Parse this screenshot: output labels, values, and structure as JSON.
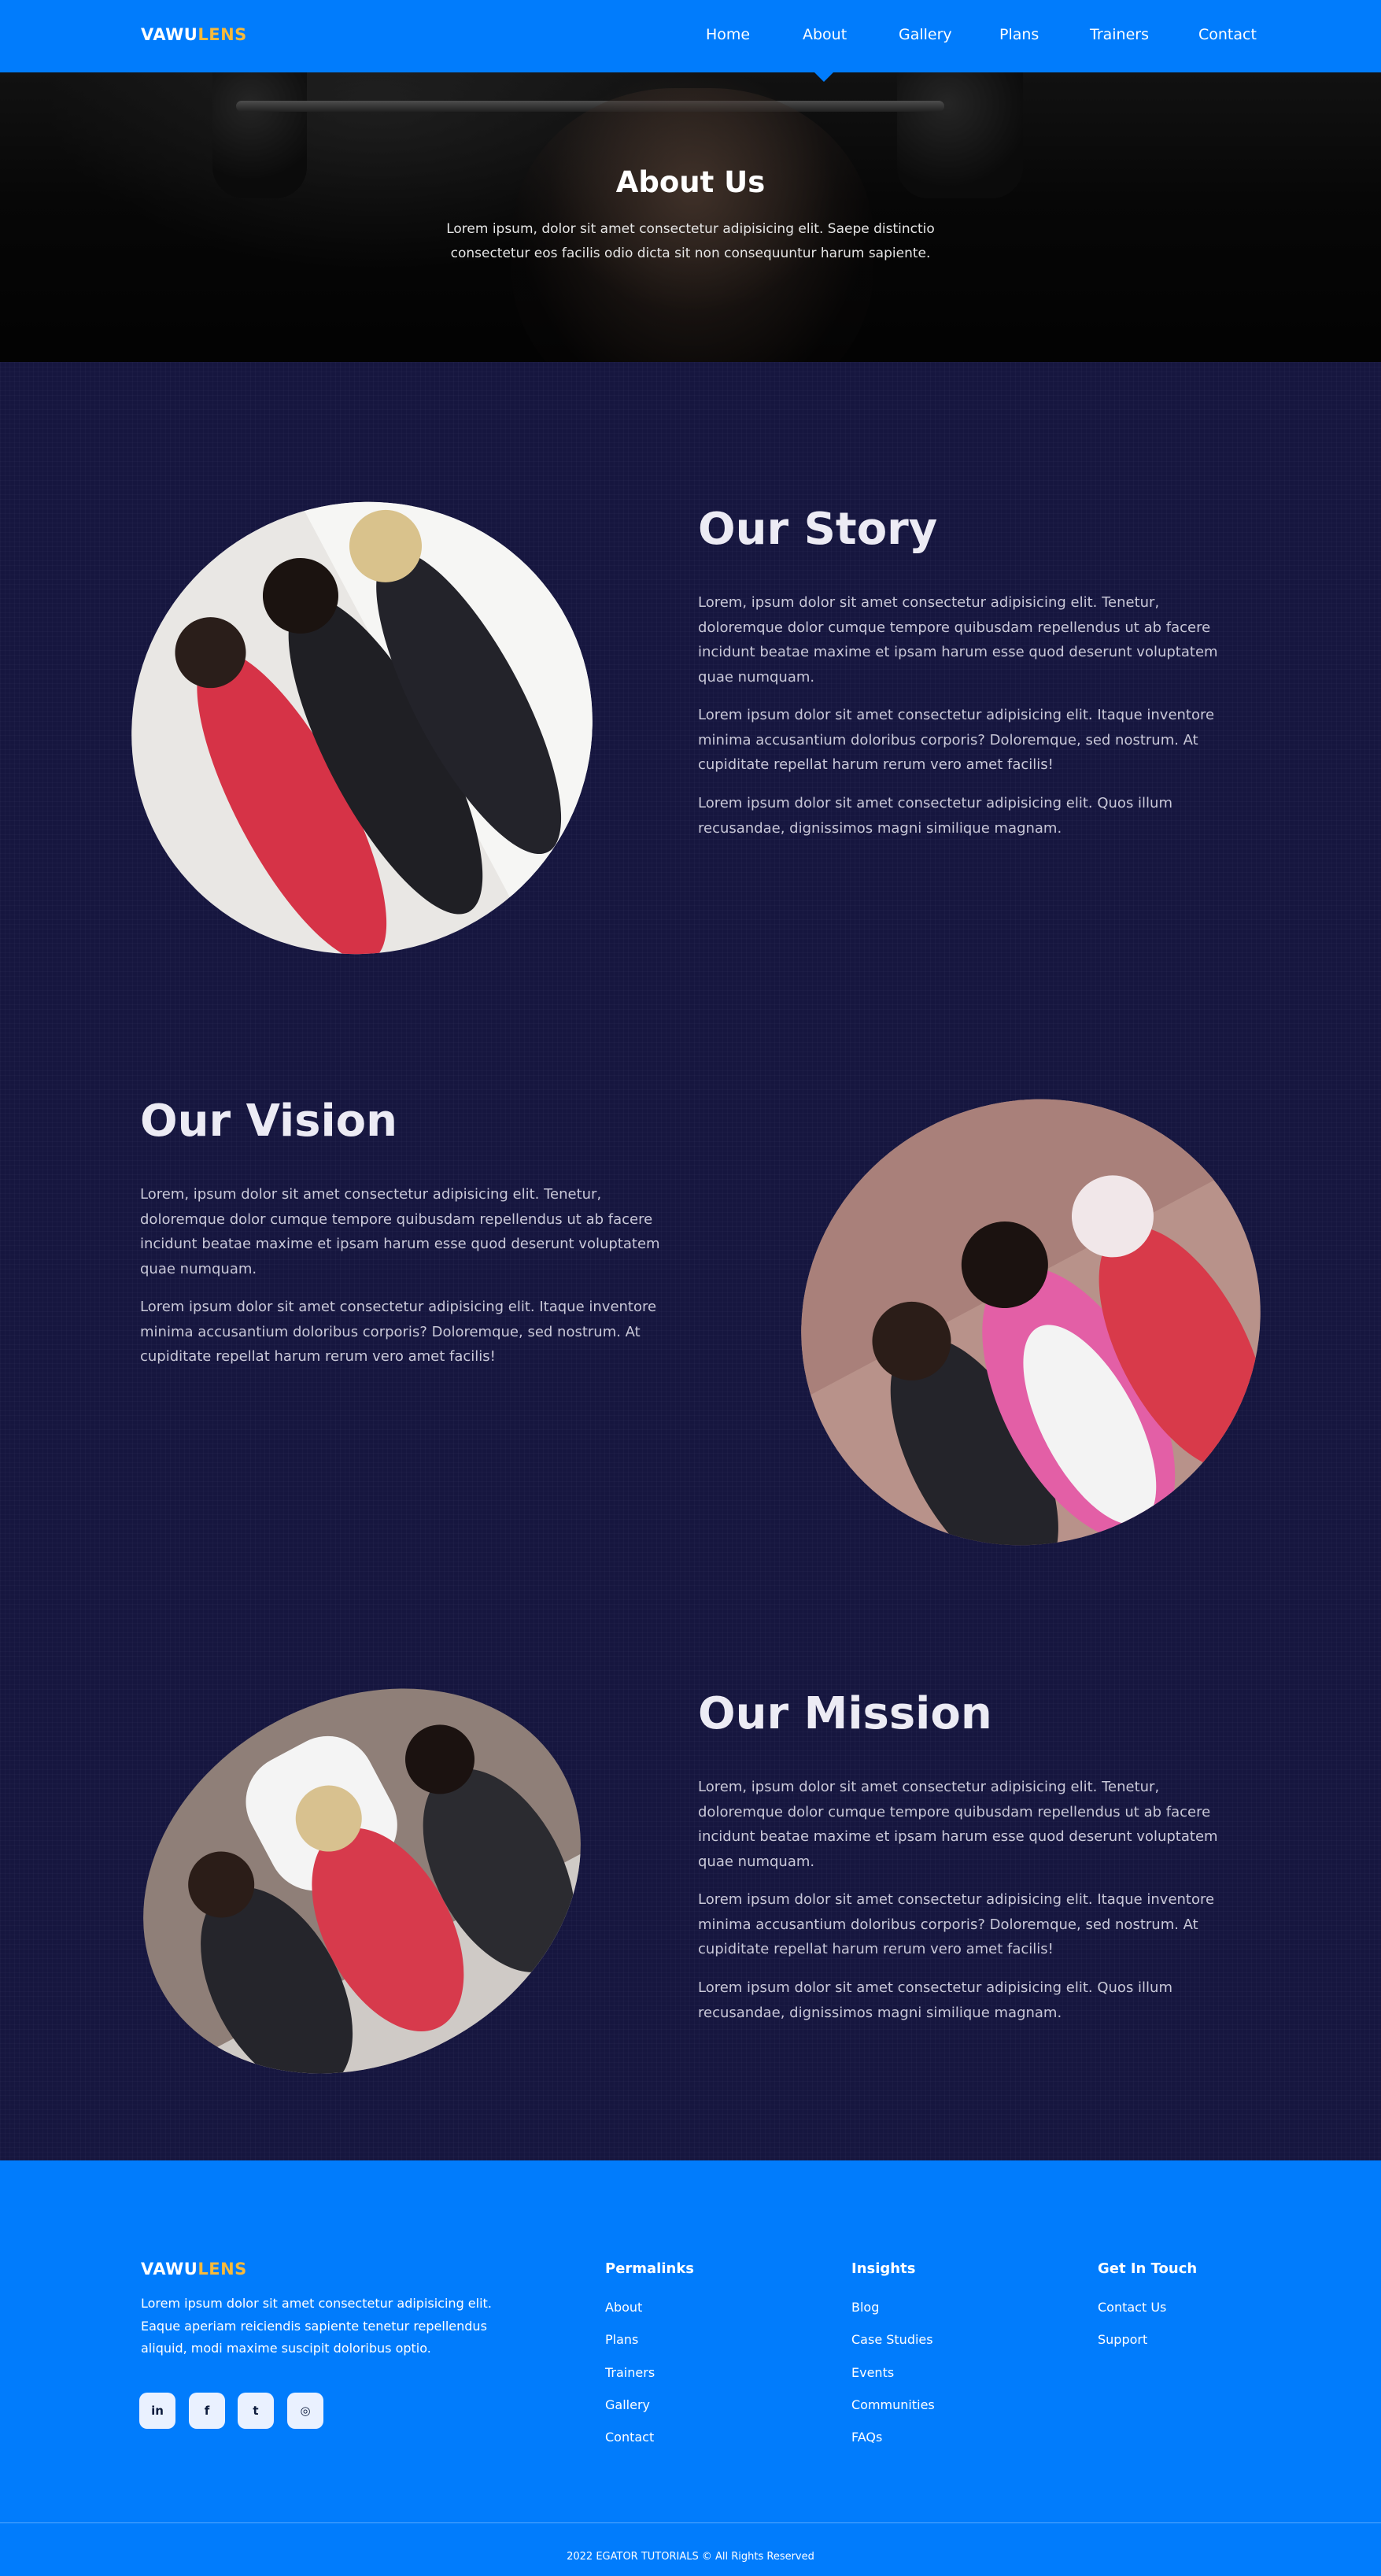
{
  "brand": {
    "part1": "VAWU",
    "part2": "LENS"
  },
  "nav": {
    "items": [
      {
        "label": "Home"
      },
      {
        "label": "About"
      },
      {
        "label": "Gallery"
      },
      {
        "label": "Plans"
      },
      {
        "label": "Trainers"
      },
      {
        "label": "Contact"
      }
    ],
    "active": "About"
  },
  "hero": {
    "title": "About Us",
    "text": "Lorem ipsum, dolor sit amet consectetur adipisicing elit. Saepe distinctio consectetur eos facilis odio dicta sit non consequuntur harum sapiente."
  },
  "story": {
    "title": "Our Story",
    "paragraphs": [
      "Lorem, ipsum dolor sit amet consectetur adipisicing elit. Tenetur, doloremque dolor cumque tempore quibusdam repellendus ut ab facere incidunt beatae maxime et ipsam harum esse quod deserunt voluptatem quae numquam.",
      "Lorem ipsum dolor sit amet consectetur adipisicing elit. Itaque inventore minima accusantium doloribus corporis? Doloremque, sed nostrum. At cupiditate repellat harum rerum vero amet facilis!",
      "Lorem ipsum dolor sit amet consectetur adipisicing elit. Quos illum recusandae, dignissimos magni similique magnam."
    ]
  },
  "vision": {
    "title": "Our Vision",
    "paragraphs": [
      "Lorem, ipsum dolor sit amet consectetur adipisicing elit. Tenetur, doloremque dolor cumque tempore quibusdam repellendus ut ab facere incidunt beatae maxime et ipsam harum esse quod deserunt voluptatem quae numquam.",
      "Lorem ipsum dolor sit amet consectetur adipisicing elit. Itaque inventore minima accusantium doloribus corporis? Doloremque, sed nostrum. At cupiditate repellat harum rerum vero amet facilis!"
    ]
  },
  "mission": {
    "title": "Our Mission",
    "paragraphs": [
      "Lorem, ipsum dolor sit amet consectetur adipisicing elit. Tenetur, doloremque dolor cumque tempore quibusdam repellendus ut ab facere incidunt beatae maxime et ipsam harum esse quod deserunt voluptatem quae numquam.",
      "Lorem ipsum dolor sit amet consectetur adipisicing elit. Itaque inventore minima accusantium doloribus corporis? Doloremque, sed nostrum. At cupiditate repellat harum rerum vero amet facilis!",
      "Lorem ipsum dolor sit amet consectetur adipisicing elit. Quos illum recusandae, dignissimos magni similique magnam."
    ]
  },
  "footer": {
    "description": "Lorem ipsum dolor sit amet consectetur adipisicing elit. Eaque aperiam reiciendis sapiente tenetur repellendus aliquid, modi maxime suscipit doloribus optio.",
    "social": [
      {
        "icon": "linkedin-icon",
        "glyph": "in"
      },
      {
        "icon": "facebook-icon",
        "glyph": "f"
      },
      {
        "icon": "twitter-icon",
        "glyph": "t"
      },
      {
        "icon": "instagram-icon",
        "glyph": "◎"
      }
    ],
    "columns": [
      {
        "heading": "Permalinks",
        "links": [
          "About",
          "Plans",
          "Trainers",
          "Gallery",
          "Contact"
        ]
      },
      {
        "heading": "Insights",
        "links": [
          "Blog",
          "Case Studies",
          "Events",
          "Communities",
          "FAQs"
        ]
      },
      {
        "heading": "Get In Touch",
        "links": [
          "Contact Us",
          "Support"
        ]
      }
    ],
    "copyright": "2022 EGATOR TUTORIALS © All Rights Reserved"
  },
  "colors": {
    "primary": "#017cfc",
    "accent": "#f6b93b",
    "background": "#16163f"
  }
}
